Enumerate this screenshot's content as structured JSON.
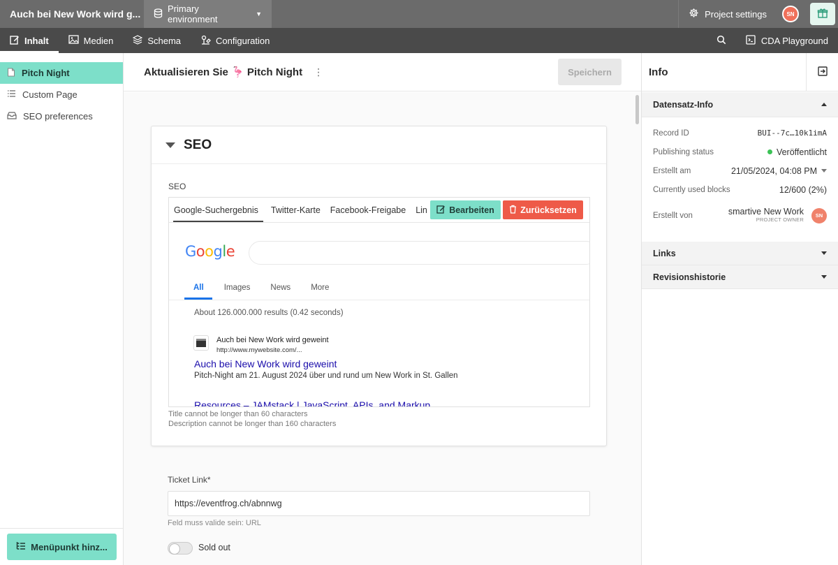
{
  "topbar": {
    "project_title": "Auch bei New Work wird g...",
    "environment": "Primary environment",
    "project_settings": "Project settings",
    "avatar_initials": "SN"
  },
  "nav": {
    "items": [
      {
        "label": "Inhalt",
        "icon": "edit-icon"
      },
      {
        "label": "Medien",
        "icon": "image-icon"
      },
      {
        "label": "Schema",
        "icon": "layers-icon"
      },
      {
        "label": "Configuration",
        "icon": "config-icon"
      }
    ],
    "cda_playground": "CDA Playground"
  },
  "sidebar": {
    "items": [
      {
        "label": "Pitch Night",
        "icon": "page-icon"
      },
      {
        "label": "Custom Page",
        "icon": "list-icon"
      },
      {
        "label": "SEO preferences",
        "icon": "inbox-icon"
      }
    ],
    "add_menu": "Menüpunkt hinz..."
  },
  "main": {
    "title": "Aktualisieren Sie 🦩 Pitch Night",
    "save": "Speichern",
    "seo_card": {
      "title": "SEO",
      "field_label": "SEO",
      "tabs": [
        "Google-Suchergebnis",
        "Twitter-Karte",
        "Facebook-Freigabe",
        "Lin"
      ],
      "edit": "Bearbeiten",
      "reset": "Zurücksetzen",
      "google": {
        "tabs": [
          "All",
          "Images",
          "News",
          "More"
        ],
        "results_count": "About 126.000.000 results (0.42 seconds)",
        "site_name": "Auch bei New Work wird geweint",
        "site_url": "http://www.mywebsite.com/...",
        "link_title": "Auch bei New Work wird geweint",
        "description": "Pitch-Night am 21. August 2024 über und rund um New Work in St. Gallen",
        "next_result": "Resources – JAMstack | JavaScript, APIs, and Markup"
      },
      "hint_title": "Title cannot be longer than 60 characters",
      "hint_description": "Description cannot be longer than 160 characters"
    },
    "ticket": {
      "label": "Ticket Link*",
      "value": "https://eventfrog.ch/abnnwg",
      "hint": "Feld muss valide sein: URL"
    },
    "sold_out": {
      "label": "Sold out",
      "checked": false
    }
  },
  "info": {
    "title": "Info",
    "record_section": "Datensatz-Info",
    "rows": {
      "record_id_label": "Record ID",
      "record_id": "BUI--7c…10k1imA",
      "publishing_status_label": "Publishing status",
      "publishing_status": "Veröffentlicht",
      "created_label": "Erstellt am",
      "created": "21/05/2024, 04:08 PM",
      "blocks_label": "Currently used blocks",
      "blocks": "12/600 (2%)",
      "created_by_label": "Erstellt von",
      "created_by": "smartive New Work",
      "created_by_role": "PROJECT OWNER",
      "created_by_initials": "SN"
    },
    "links_section": "Links",
    "revisions_section": "Revisionshistorie"
  },
  "colors": {
    "accent": "#7ddfc9",
    "danger": "#ee5a48",
    "topbar": "#6b6b6b",
    "navbar": "#4a4a4a",
    "published": "#3cc256"
  }
}
